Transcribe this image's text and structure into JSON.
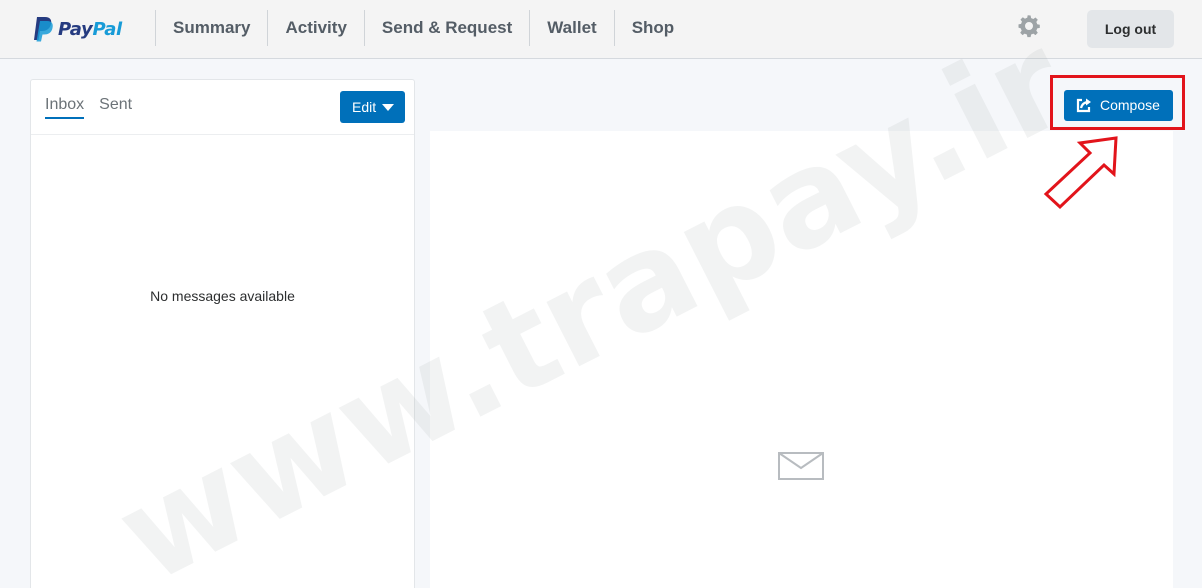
{
  "header": {
    "logo": {
      "pay": "Pay",
      "pal": "Pal"
    },
    "nav": [
      "Summary",
      "Activity",
      "Send & Request",
      "Wallet",
      "Shop"
    ],
    "settings_icon": "gear-icon",
    "logout_label": "Log out"
  },
  "messages": {
    "tabs": [
      "Inbox",
      "Sent"
    ],
    "active_tab": "Inbox",
    "edit_label": "Edit",
    "empty_text": "No messages available"
  },
  "compose": {
    "label": "Compose",
    "icon": "compose-icon"
  },
  "viewer": {
    "placeholder_icon": "envelope-icon"
  },
  "annotation": {
    "color": "#e2141b"
  },
  "watermark": {
    "text": "www.trapay.ir"
  },
  "colors": {
    "accent": "#0070ba",
    "brand_dark": "#253b80",
    "brand_light": "#179bd7"
  }
}
